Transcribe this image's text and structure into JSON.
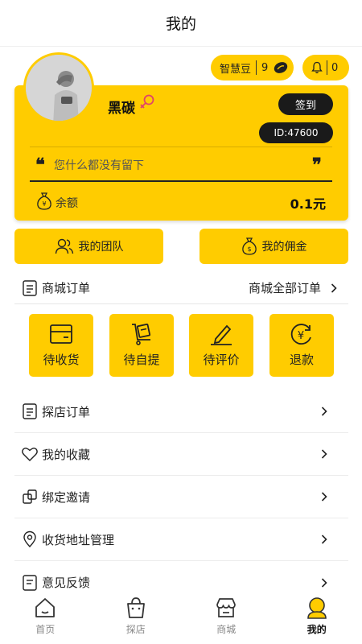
{
  "header": {
    "title": "我的"
  },
  "top_pills": {
    "beans_label": "智慧豆",
    "beans_count": "9",
    "bell_count": "0"
  },
  "profile": {
    "username": "黑碳",
    "signin_label": "签到",
    "id_text": "ID:47600",
    "motto": "您什么都没有留下",
    "balance_label": "余额",
    "balance_value": "0.1元"
  },
  "quick_buttons": {
    "team": "我的团队",
    "commission": "我的佣金"
  },
  "mall_orders": {
    "title": "商城订单",
    "all_orders": "商城全部订单",
    "tiles": [
      "待收货",
      "待自提",
      "待评价",
      "退款"
    ]
  },
  "list": [
    "探店订单",
    "我的收藏",
    "绑定邀请",
    "收货地址管理",
    "意见反馈"
  ],
  "tabbar": {
    "tabs": [
      "首页",
      "探店",
      "商城",
      "我的"
    ],
    "active": "我的"
  },
  "colors": {
    "accent": "#FFCC00",
    "dark": "#1a1a1a"
  }
}
